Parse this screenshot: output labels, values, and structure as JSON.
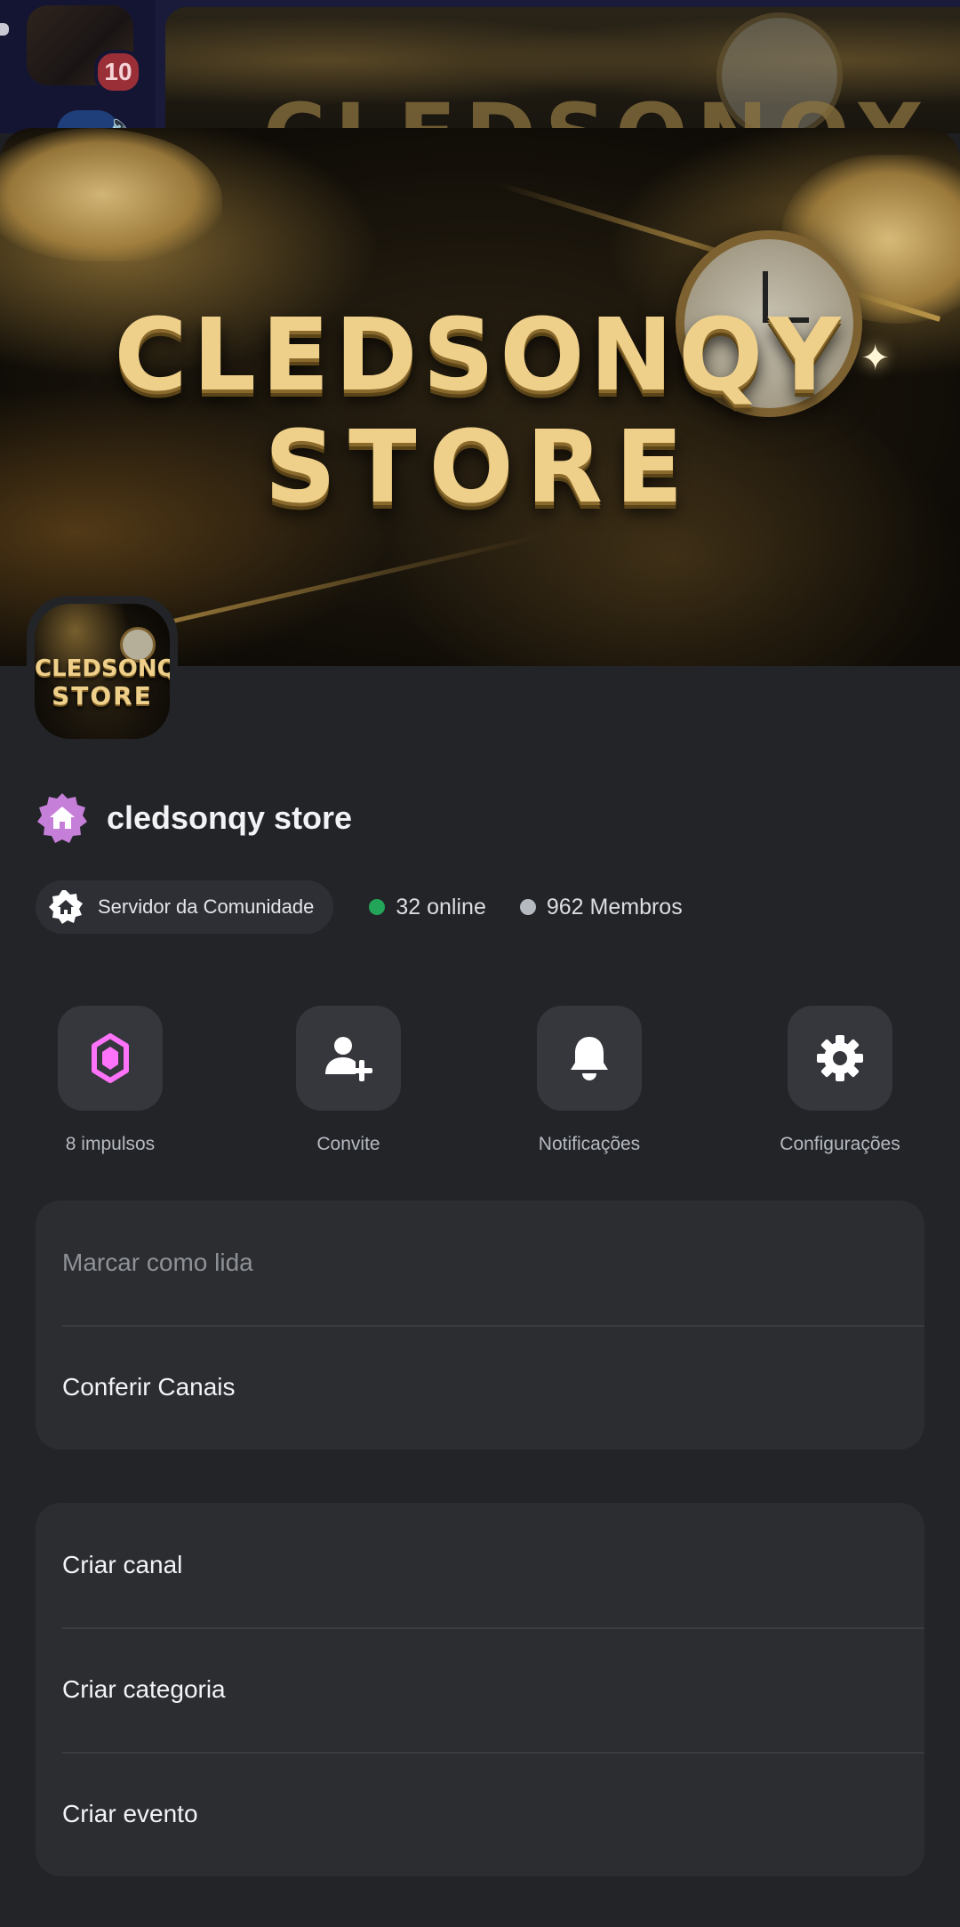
{
  "background": {
    "unread_badge": "10"
  },
  "server": {
    "name": "cledsonqy store",
    "banner_line1": "CLEDSONQY",
    "banner_line2": "STORE",
    "icon_line1": "CLEDSONQY",
    "icon_line2": "STORE",
    "community_label": "Servidor da Comunidade",
    "online_count": "32 online",
    "member_count": "962 Membros"
  },
  "actions": [
    {
      "label": "8 impulsos",
      "icon": "boost-gem-icon"
    },
    {
      "label": "Convite",
      "icon": "invite-person-add-icon"
    },
    {
      "label": "Notificações",
      "icon": "bell-icon"
    },
    {
      "label": "Configurações",
      "icon": "gear-icon"
    }
  ],
  "menu_primary": [
    {
      "label": "Marcar como lida",
      "disabled": true
    },
    {
      "label": "Conferir Canais",
      "disabled": false
    }
  ],
  "menu_create": [
    {
      "label": "Criar canal"
    },
    {
      "label": "Criar categoria"
    },
    {
      "label": "Criar evento"
    }
  ],
  "colors": {
    "sheet_background": "#232428",
    "card_background": "#2b2d31",
    "online_green": "#23a559",
    "offline_gray": "#b5bac1",
    "boost_pink": "#ff73fa",
    "community_badge": "#c67fd9"
  }
}
